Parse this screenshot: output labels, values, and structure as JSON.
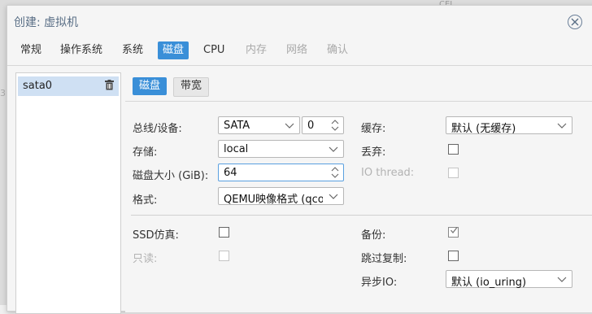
{
  "window": {
    "title": "创建: 虚拟机"
  },
  "background": {
    "top_text": "CEI",
    "left_num": "3"
  },
  "tabs": [
    {
      "label": "常规",
      "state": "normal"
    },
    {
      "label": "操作系统",
      "state": "normal"
    },
    {
      "label": "系统",
      "state": "normal"
    },
    {
      "label": "磁盘",
      "state": "active"
    },
    {
      "label": "CPU",
      "state": "normal"
    },
    {
      "label": "内存",
      "state": "disabled"
    },
    {
      "label": "网络",
      "state": "disabled"
    },
    {
      "label": "确认",
      "state": "disabled"
    }
  ],
  "sidebar": {
    "items": [
      {
        "label": "sata0",
        "icon": "trash-icon"
      }
    ]
  },
  "subtabs": [
    {
      "label": "磁盘",
      "state": "active"
    },
    {
      "label": "带宽",
      "state": "inactive"
    }
  ],
  "form": {
    "bus_device": {
      "label": "总线/设备:",
      "bus_value": "SATA",
      "device_value": "0"
    },
    "storage": {
      "label": "存储:",
      "value": "local"
    },
    "disk_size": {
      "label": "磁盘大小 (GiB):",
      "value": "64"
    },
    "format": {
      "label": "格式:",
      "value": "QEMU映像格式 (qco"
    },
    "cache": {
      "label": "缓存:",
      "value": "默认 (无缓存)"
    },
    "discard": {
      "label": "丢弃:",
      "checked": false
    },
    "io_thread": {
      "label": "IO thread:",
      "checked": false,
      "disabled": true
    },
    "ssd_emulation": {
      "label": "SSD仿真:",
      "checked": false
    },
    "readonly": {
      "label": "只读:",
      "checked": false,
      "disabled": true
    },
    "backup": {
      "label": "备份:",
      "checked": true
    },
    "skip_replication": {
      "label": "跳过复制:",
      "checked": false
    },
    "async_io": {
      "label": "异步IO:",
      "value": "默认 (io_uring)"
    }
  },
  "colors": {
    "accent": "#3a8fd8",
    "title": "#5a6f86",
    "selected_row": "#cfe0f3"
  }
}
